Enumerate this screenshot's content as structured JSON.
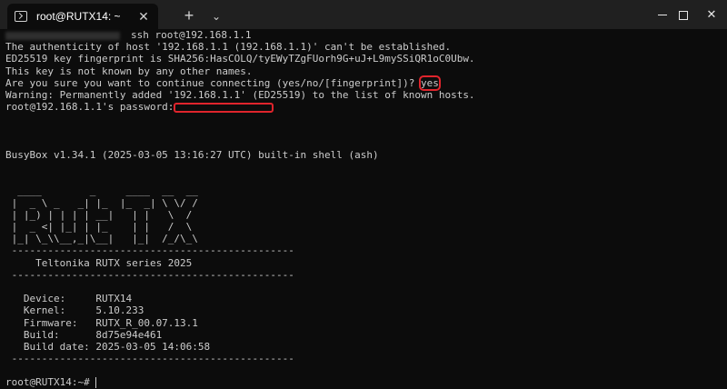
{
  "window": {
    "tab_title": "root@RUTX14: ~",
    "close_tab_glyph": "✕",
    "new_tab_glyph": "+",
    "dropdown_glyph": "⌄",
    "close_glyph": "✕"
  },
  "terminal": {
    "ssh_cmd": "ssh root@192.168.1.1",
    "lines_pre": [
      "The authenticity of host '192.168.1.1 (192.168.1.1)' can't be established.",
      "ED25519 key fingerprint is SHA256:HasCOLQ/tyEWyTZgFUorh9G+uJ+L9mySSiQR1oC0Ubw.",
      "This key is not known by any other names."
    ],
    "confirm_prompt": "Are you sure you want to continue connecting (yes/no/[fingerprint])? ",
    "confirm_answer": "yes",
    "warning": "Warning: Permanently added '192.168.1.1' (ED25519) to the list of known hosts.",
    "password_prompt": "root@192.168.1.1's password:",
    "busybox": "BusyBox v1.34.1 (2025-03-05 13:16:27 UTC) built-in shell (ash)",
    "banner": [
      "  ____        _     ____  __  __",
      " |  _ \\ _   _| |_  |_  _| \\ \\/ /",
      " | |_) | | | | __|   | |   \\  / ",
      " |  _ <| |_| | |_    | |   /  \\ ",
      " |_| \\_\\\\__,_|\\__|   |_|  /_/\\_\\"
    ],
    "separator": " -----------------------------------------------",
    "series": "     Teltonika RUTX series 2025",
    "info": [
      "   Device:     RUTX14",
      "   Kernel:     5.10.233",
      "   Firmware:   RUTX_R_00.07.13.1",
      "   Build:      8d75e94e461",
      "   Build date: 2025-03-05 14:06:58"
    ],
    "prompt": "root@RUTX14:~# "
  },
  "colors": {
    "highlight": "#e0242c",
    "background": "#0c0c0c",
    "text": "#cccccc"
  }
}
